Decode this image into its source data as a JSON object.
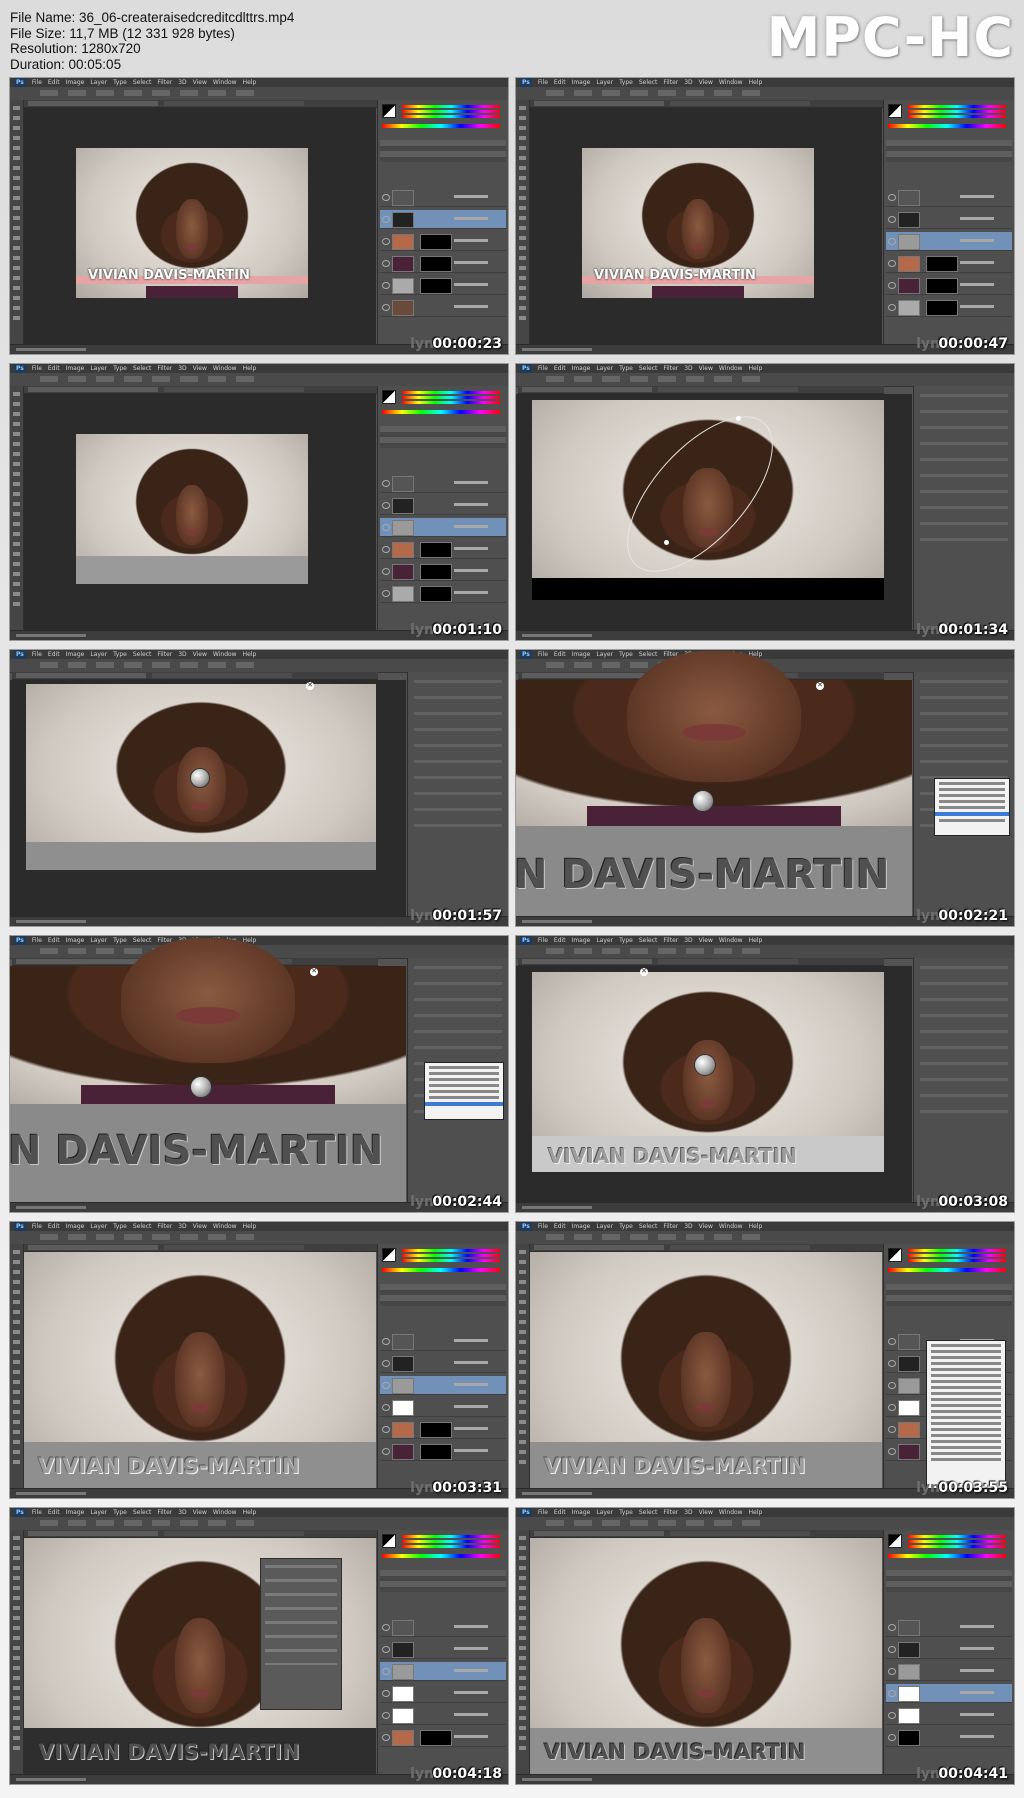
{
  "file_info": {
    "name_label": "File Name: 36_06-createraisedcreditcdlttrs.mp4",
    "size_label": "File Size: 11,7 MB (12 331 928 bytes)",
    "resolution_label": "Resolution: 1280x720",
    "duration_label": "Duration: 00:05:05"
  },
  "brand": "MPC-HC",
  "app": {
    "logo": "Ps",
    "menu": [
      "File",
      "Edit",
      "Image",
      "Layer",
      "Type",
      "Select",
      "Filter",
      "3D",
      "View",
      "Window",
      "Help"
    ]
  },
  "watermark": "lynd",
  "title_text": "VIVIAN DAVIS-MARTIN",
  "title_text_cropped": "N DAVIS-MARTIN",
  "frames": [
    {
      "timestamp": "00:00:23"
    },
    {
      "timestamp": "00:00:47"
    },
    {
      "timestamp": "00:01:10"
    },
    {
      "timestamp": "00:01:34"
    },
    {
      "timestamp": "00:01:57"
    },
    {
      "timestamp": "00:02:21"
    },
    {
      "timestamp": "00:02:44"
    },
    {
      "timestamp": "00:03:08"
    },
    {
      "timestamp": "00:03:31"
    },
    {
      "timestamp": "00:03:55"
    },
    {
      "timestamp": "00:04:18"
    },
    {
      "timestamp": "00:04:41"
    }
  ],
  "colors": {
    "selected_layer": "#7191b8",
    "text_bar_pink": "#e6a4a4"
  }
}
